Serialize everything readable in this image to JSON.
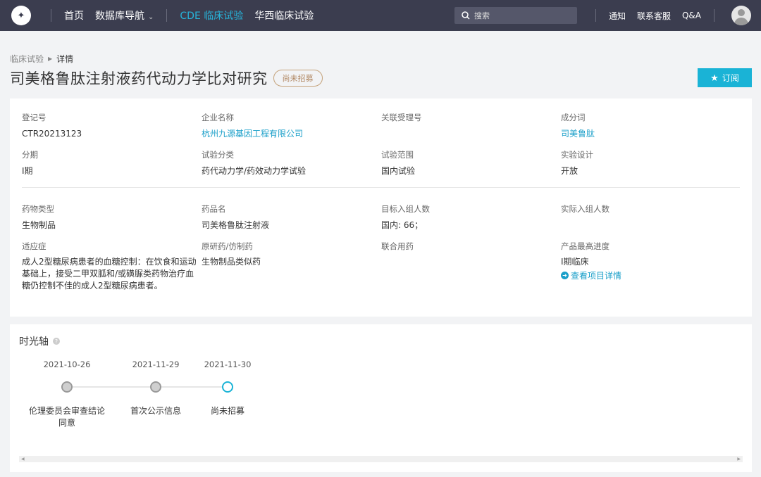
{
  "nav": {
    "home": "首页",
    "database_nav": "数据库导航",
    "cde": "CDE 临床试验",
    "huaxi": "华西临床试验",
    "search_placeholder": "搜索",
    "notify": "通知",
    "support": "联系客服",
    "qa": "Q&A"
  },
  "breadcrumb": {
    "parent": "临床试验",
    "current": "详情"
  },
  "page": {
    "title": "司美格鲁肽注射液药代动力学比对研究",
    "status_badge": "尚未招募",
    "subscribe_label": "订阅"
  },
  "details": {
    "reg_no": {
      "label": "登记号",
      "value": "CTR20213123"
    },
    "company": {
      "label": "企业名称",
      "value": "杭州九源基因工程有限公司"
    },
    "acceptance": {
      "label": "关联受理号",
      "value": ""
    },
    "ingredient": {
      "label": "成分词",
      "value": "司美鲁肽"
    },
    "phase": {
      "label": "分期",
      "value": "I期"
    },
    "trial_type": {
      "label": "试验分类",
      "value": "药代动力学/药效动力学试验"
    },
    "scope": {
      "label": "试验范围",
      "value": "国内试验"
    },
    "design": {
      "label": "实验设计",
      "value": "开放"
    },
    "drug_type": {
      "label": "药物类型",
      "value": "生物制品"
    },
    "drug_name": {
      "label": "药品名",
      "value": "司美格鲁肽注射液"
    },
    "target_enroll": {
      "label": "目标入组人数",
      "value": "国内: 66；"
    },
    "actual_enroll": {
      "label": "实际入组人数",
      "value": ""
    },
    "indication": {
      "label": "适应症",
      "value": "成人2型糖尿病患者的血糖控制：在饮食和运动基础上，接受二甲双胍和/或磺脲类药物治疗血糖仍控制不佳的成人2型糖尿病患者。"
    },
    "original": {
      "label": "原研药/仿制药",
      "value": "生物制品类似药"
    },
    "combo": {
      "label": "联合用药",
      "value": ""
    },
    "progress": {
      "label": "产品最高进度",
      "value": "I期临床",
      "link": "查看项目详情"
    }
  },
  "timeline": {
    "title": "时光轴",
    "events": [
      {
        "date": "2021-10-26",
        "label": "伦理委员会审查结论同意"
      },
      {
        "date": "2021-11-29",
        "label": "首次公示信息"
      },
      {
        "date": "2021-11-30",
        "label": "尚未招募"
      }
    ]
  }
}
